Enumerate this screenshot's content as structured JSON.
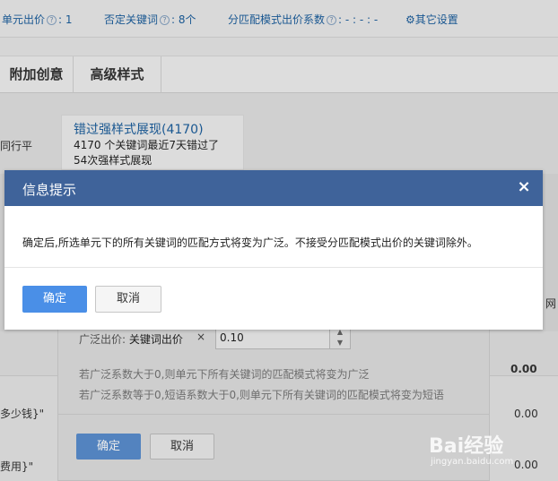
{
  "top_bar": {
    "unit_bid_label": "单元出价",
    "unit_bid_value": ": 1",
    "negative_kw_label": "否定关键词",
    "negative_kw_value": ": 8个",
    "match_coef_label": "分匹配模式出价系数",
    "match_coef_value": ": - : - : -",
    "other_settings": "其它设置"
  },
  "tabs": [
    "附加创意",
    "高级样式"
  ],
  "card": {
    "title": "错过强样式展现(4170)",
    "line1": "4170 个关键词最近7天错过了",
    "line2": "54次强样式展现"
  },
  "left_fragments": {
    "frag1": "同行平",
    "frag2": "多少钱}\"",
    "frag3": "费用}\""
  },
  "table_values": [
    "0.00",
    "0.00",
    "0.00"
  ],
  "right_fragment": "网",
  "sub_dialog": {
    "label_prefix": "广泛出价:",
    "label_bold": "关键词出价",
    "multiply": "×",
    "input_value": "0.10",
    "hint1": "若广泛系数大于0,则单元下所有关键词的匹配模式将变为广泛",
    "hint2": "若广泛系数等于0,短语系数大于0,则单元下所有关键词的匹配模式将变为短语",
    "confirm_label": "确定",
    "cancel_label": "取消"
  },
  "modal": {
    "title": "信息提示",
    "close_glyph": "×",
    "message": "确定后,所选单元下的所有关键词的匹配方式将变为广泛。不接受分匹配模式出价的关键词除外。",
    "confirm_label": "确定",
    "cancel_label": "取消"
  },
  "watermark": {
    "logo": "Bai经验",
    "url": "jingyan.baidu.com"
  }
}
